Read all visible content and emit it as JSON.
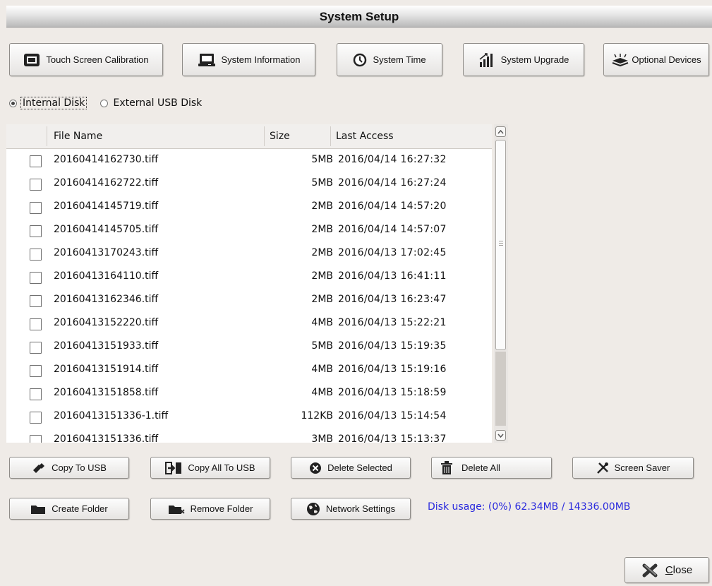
{
  "window": {
    "title": "System Setup"
  },
  "top_buttons": [
    {
      "label": "Touch Screen Calibration",
      "icon": "monitor-icon"
    },
    {
      "label": "System Information",
      "icon": "laptop-icon"
    },
    {
      "label": "System Time",
      "icon": "clock-icon"
    },
    {
      "label": "System Upgrade",
      "icon": "signal-bars-icon"
    },
    {
      "label": "Optional Devices",
      "icon": "scanner-icon"
    }
  ],
  "disk_select": {
    "options": [
      "Internal Disk",
      "External USB Disk"
    ],
    "selected": "Internal Disk"
  },
  "file_list": {
    "columns": [
      "File Name",
      "Size",
      "Last Access"
    ],
    "rows": [
      {
        "name": "20160414162730.tiff",
        "size": "5MB",
        "date": "2016/04/14 16:27:32"
      },
      {
        "name": "20160414162722.tiff",
        "size": "5MB",
        "date": "2016/04/14 16:27:24"
      },
      {
        "name": "20160414145719.tiff",
        "size": "2MB",
        "date": "2016/04/14 14:57:20"
      },
      {
        "name": "20160414145705.tiff",
        "size": "2MB",
        "date": "2016/04/14 14:57:07"
      },
      {
        "name": "20160413170243.tiff",
        "size": "2MB",
        "date": "2016/04/13 17:02:45"
      },
      {
        "name": "20160413164110.tiff",
        "size": "2MB",
        "date": "2016/04/13 16:41:11"
      },
      {
        "name": "20160413162346.tiff",
        "size": "2MB",
        "date": "2016/04/13 16:23:47"
      },
      {
        "name": "20160413152220.tiff",
        "size": "4MB",
        "date": "2016/04/13 15:22:21"
      },
      {
        "name": "20160413151933.tiff",
        "size": "5MB",
        "date": "2016/04/13 15:19:35"
      },
      {
        "name": "20160413151914.tiff",
        "size": "4MB",
        "date": "2016/04/13 15:19:16"
      },
      {
        "name": "20160413151858.tiff",
        "size": "4MB",
        "date": "2016/04/13 15:18:59"
      },
      {
        "name": "20160413151336-1.tiff",
        "size": "112KB",
        "date": "2016/04/13 15:14:54"
      },
      {
        "name": "20160413151336.tiff",
        "size": "3MB",
        "date": "2016/04/13 15:13:37"
      }
    ]
  },
  "actions": {
    "copy_to_usb": "Copy To USB",
    "copy_all_to_usb": "Copy All To USB",
    "delete_selected": "Delete Selected",
    "delete_all": "Delete All",
    "screen_saver": "Screen Saver",
    "create_folder": "Create Folder",
    "remove_folder": "Remove Folder",
    "network_settings": "Network Settings"
  },
  "disk_usage": "Disk usage: (0%) 62.34MB / 14336.00MB",
  "close": {
    "mnemonic": "C",
    "rest": "lose",
    "icon": "close-x-icon"
  },
  "colors": {
    "usage_text": "#2a2add",
    "background": "#efebe7"
  }
}
